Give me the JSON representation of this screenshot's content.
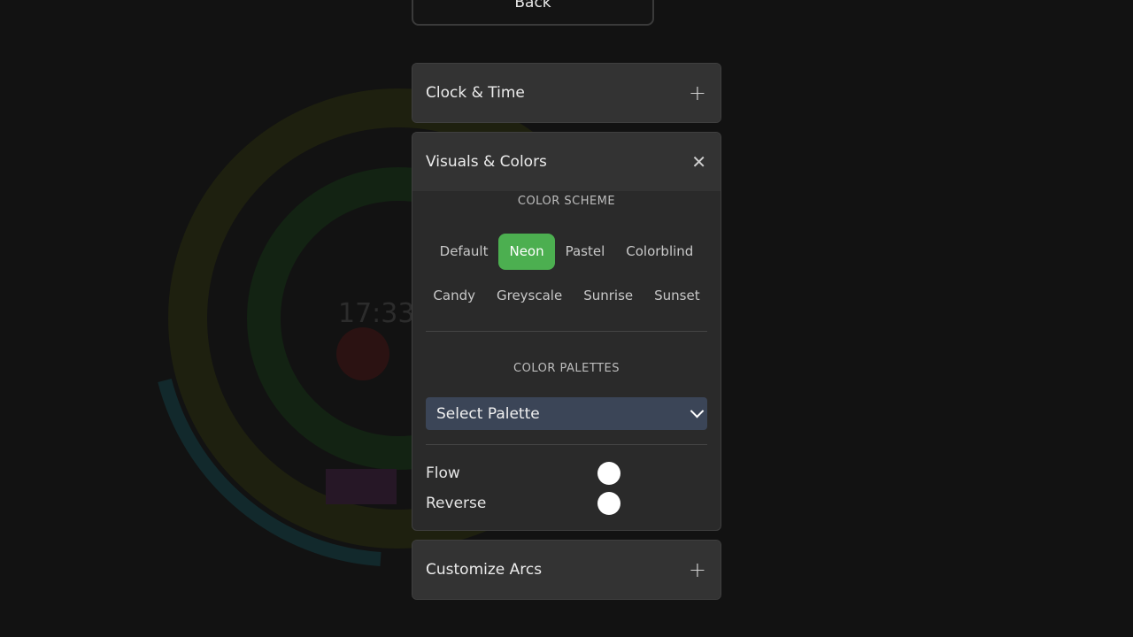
{
  "nav": {
    "back_label": "Back"
  },
  "background": {
    "time": "17:33"
  },
  "panels": {
    "clock": {
      "title": "Clock & Time",
      "icon": "plus-icon",
      "expanded": false
    },
    "visuals": {
      "title": "Visuals & Colors",
      "icon": "close-icon",
      "expanded": true,
      "color_scheme": {
        "title": "COLOR SCHEME",
        "row1": [
          "Default",
          "Neon",
          "Pastel",
          "Colorblind"
        ],
        "row2": [
          "Candy",
          "Greyscale",
          "Sunrise",
          "Sunset"
        ],
        "selected": "Neon"
      },
      "color_palettes": {
        "title": "COLOR PALETTES",
        "select_value": "Select Palette"
      },
      "toggles": [
        {
          "label": "Flow",
          "on": false
        },
        {
          "label": "Reverse",
          "on": false
        }
      ]
    },
    "arcs": {
      "title": "Customize Arcs",
      "icon": "plus-icon",
      "expanded": false
    }
  },
  "colors": {
    "accent": "#4caf50",
    "select_bg": "#3b4557"
  }
}
